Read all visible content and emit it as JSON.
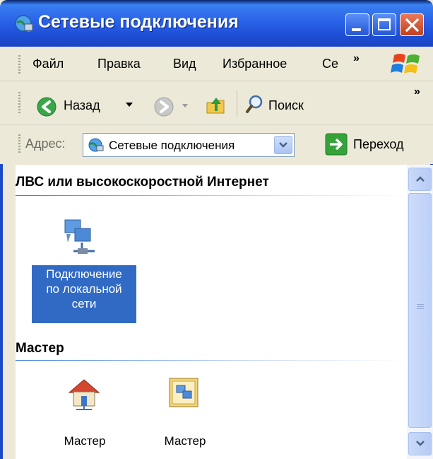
{
  "window": {
    "title": "Сетевые подключения",
    "icon": "network-connections-icon"
  },
  "menu": {
    "items": [
      "Файл",
      "Правка",
      "Вид",
      "Избранное",
      "Се"
    ],
    "more": "»"
  },
  "toolbar": {
    "back_label": "Назад",
    "search_label": "Поиск",
    "more": "»"
  },
  "address": {
    "label": "Адрес:",
    "value": "Сетевые подключения",
    "go_label": "Переход"
  },
  "sections": [
    {
      "title": "ЛВС или высокоскоростной Интернет",
      "items": [
        {
          "label_lines": [
            "Подключение",
            "по локальной",
            "сети"
          ],
          "selected": true,
          "icon": "lan-connection-icon"
        }
      ]
    },
    {
      "title": "Мастер",
      "items": [
        {
          "label_lines": [
            "Мастер"
          ],
          "icon": "home-network-wizard-icon"
        },
        {
          "label_lines": [
            "Мастер"
          ],
          "icon": "network-setup-wizard-icon"
        }
      ]
    }
  ],
  "colors": {
    "titlebar": "#2A63E8",
    "selection": "#316AC5",
    "close_button": "#D0502D",
    "go_arrow": "#36A33A"
  }
}
